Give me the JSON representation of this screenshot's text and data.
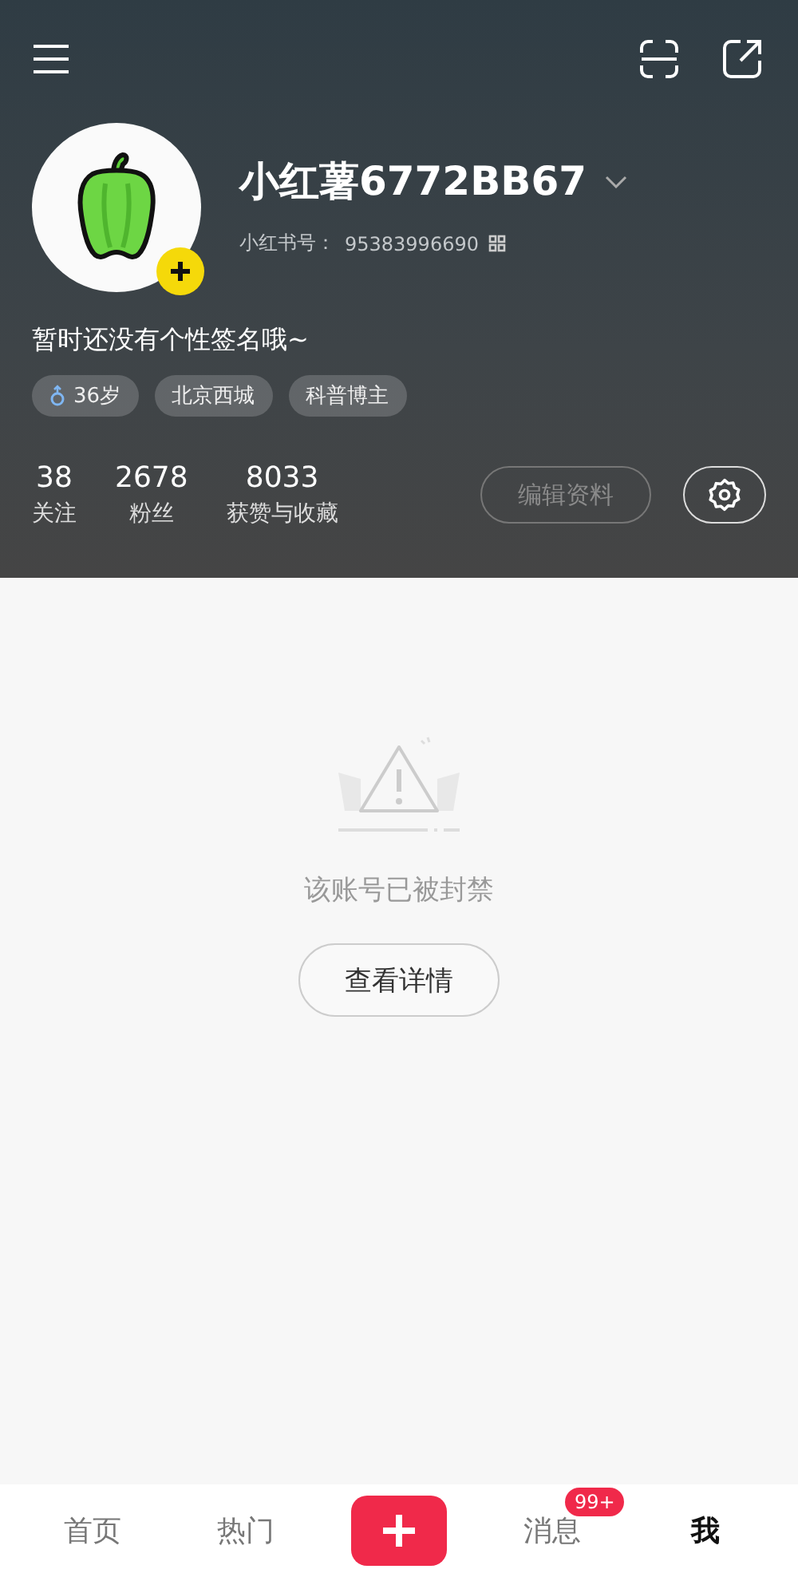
{
  "profile": {
    "name": "小红薯6772BB67",
    "id_label": "小红书号：",
    "id_value": "95383996690",
    "bio": "暂时还没有个性签名哦~",
    "tags": [
      {
        "kind": "gender",
        "label": "36岁"
      },
      {
        "kind": "plain",
        "label": "北京西城"
      },
      {
        "kind": "plain",
        "label": "科普博主"
      }
    ],
    "stats": [
      {
        "value": "38",
        "label": "关注"
      },
      {
        "value": "2678",
        "label": "粉丝"
      },
      {
        "value": "8033",
        "label": "获赞与收藏"
      }
    ],
    "edit_button": {
      "label": "编辑资料",
      "disabled": true
    }
  },
  "notice": {
    "message": "该账号已被封禁",
    "button": "查看详情"
  },
  "bottom_nav": [
    {
      "kind": "tab",
      "label": "首页",
      "selected": false
    },
    {
      "kind": "tab",
      "label": "热门",
      "selected": false
    },
    {
      "kind": "add"
    },
    {
      "kind": "tab",
      "label": "消息",
      "selected": false,
      "badge": "99+"
    },
    {
      "kind": "tab",
      "label": "我",
      "selected": true
    }
  ]
}
